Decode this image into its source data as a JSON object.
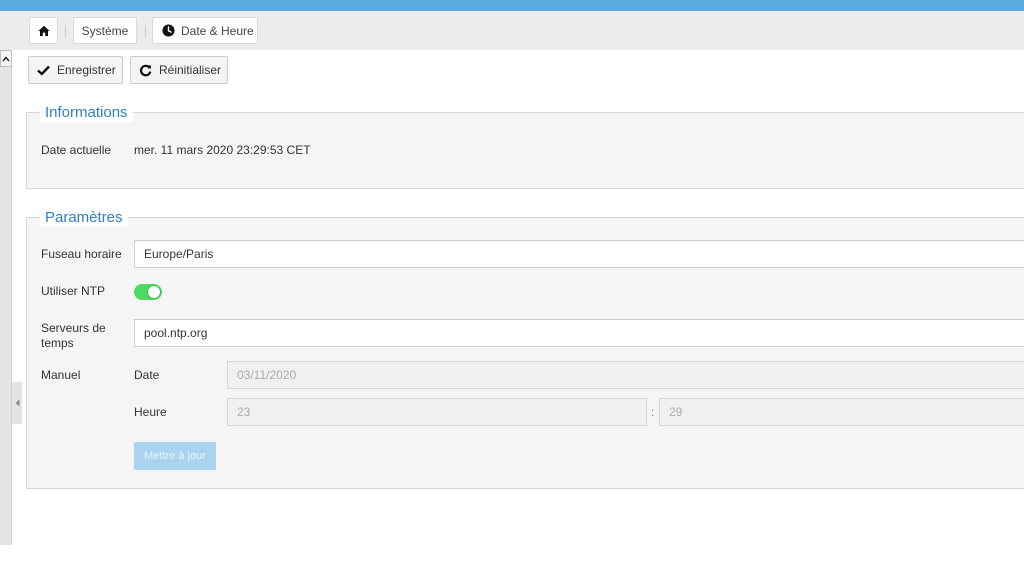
{
  "breadcrumb": {
    "home_icon": "home-icon",
    "system": "Système",
    "datetime": "Date & Heure",
    "datetime_icon": "clock-icon"
  },
  "toolbar": {
    "save_label": "Enregistrer",
    "save_icon": "check-icon",
    "reset_label": "Réinitialiser",
    "reset_icon": "refresh-icon"
  },
  "informations": {
    "title": "Informations",
    "current_date_label": "Date actuelle",
    "current_date_value": "mer. 11 mars 2020 23:29:53 CET"
  },
  "parametres": {
    "title": "Paramètres",
    "timezone_label": "Fuseau horaire",
    "timezone_value": "Europe/Paris",
    "ntp_label": "Utiliser NTP",
    "ntp_enabled": true,
    "servers_label": "Serveurs de temps",
    "servers_value": "pool.ntp.org",
    "manual_label": "Manuel",
    "date_label": "Date",
    "date_value": "03/11/2020",
    "time_label": "Heure",
    "hour_value": "23",
    "time_separator": ":",
    "minute_value": "29",
    "update_label": "Mettre à jour"
  },
  "colors": {
    "accent": "#2f80c2",
    "topbar": "#5aaae0",
    "toggle_on": "#4cd964",
    "update_button": "#a9d3f1"
  }
}
